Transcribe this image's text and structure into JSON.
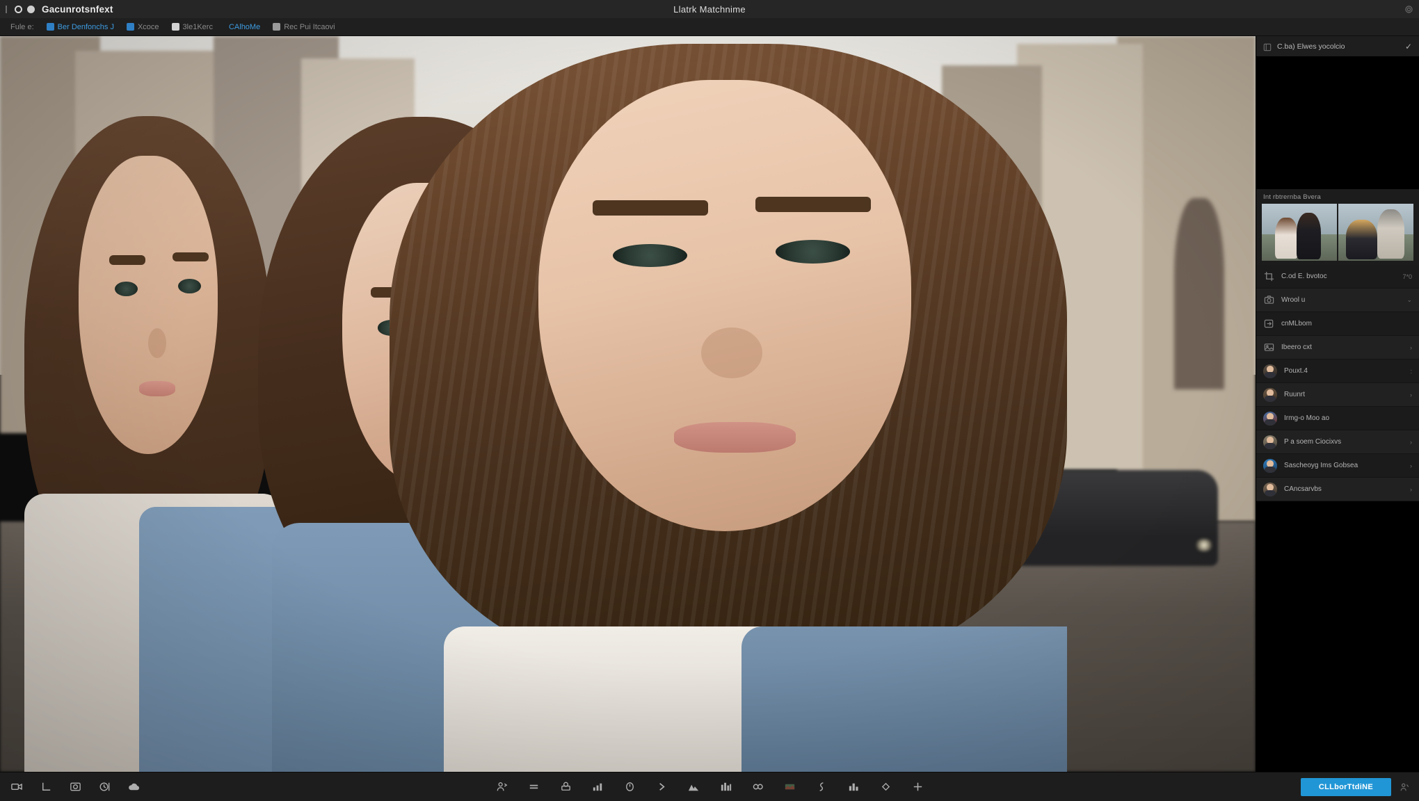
{
  "titlebar": {
    "app_name": "Gacunrotsnfext",
    "window_title": "Llatrk Matchnime",
    "drag_handle_icon": "drag-handle-icon",
    "logo_icon": "app-logo-icon",
    "status_dot_icon": "status-dot-icon",
    "settings_icon": "gear-icon"
  },
  "menubar": {
    "items": [
      {
        "label": "Fule e:",
        "icon": "none",
        "style": "muted"
      },
      {
        "label": "Ber Denfonchs J",
        "icon": "blue",
        "style": "accent"
      },
      {
        "label": "Xcoce",
        "icon": "blue",
        "style": "muted"
      },
      {
        "label": "3le1Kerc",
        "icon": "white",
        "style": "muted"
      },
      {
        "label": "CAlhoMe",
        "icon": "none",
        "style": "accent"
      },
      {
        "label": "Rec Pui Itcaovi",
        "icon": "grey",
        "style": "muted"
      }
    ]
  },
  "canvas": {
    "name": "photo-canvas",
    "description": "Street portrait photograph of three women"
  },
  "sidebar": {
    "header": {
      "label": "C.ba) Elwes yocolcio",
      "icon": "panel-icon",
      "check": "✓"
    },
    "section_title": "Int rbtrernba Bvera",
    "thumbnails": [
      {
        "name": "thumbnail-1"
      },
      {
        "name": "thumbnail-2"
      }
    ],
    "rows": [
      {
        "icon": "crop-icon",
        "label": "C.od E. bvotoc",
        "meta": "7*0",
        "chev": ""
      },
      {
        "icon": "camera-icon",
        "label": "Wrool u",
        "meta": "",
        "chev": "⌄"
      },
      {
        "icon": "tag-icon",
        "label": "cnMLbom",
        "meta": "",
        "chev": ""
      },
      {
        "icon": "image-icon",
        "label": "Ibeero cxt",
        "meta": "",
        "chev": "›"
      },
      {
        "icon": "avatar",
        "label": "Pouxt.4",
        "meta": "",
        "chev": ":"
      },
      {
        "icon": "avatar",
        "label": "Ruunrt",
        "meta": "",
        "chev": "›"
      },
      {
        "icon": "avatar",
        "label": "Irmg-o Moo ao",
        "meta": "",
        "chev": ""
      },
      {
        "icon": "avatar",
        "label": "P a soem Ciocixvs",
        "meta": "",
        "chev": "›"
      },
      {
        "icon": "avatar",
        "label": "Sascheoyg Ims Gobsea",
        "meta": "",
        "chev": "›"
      },
      {
        "icon": "avatar",
        "label": "CAncsarvbs",
        "meta": "",
        "chev": "›"
      }
    ]
  },
  "bottombar": {
    "left_tools": [
      {
        "name": "video-camera-icon"
      },
      {
        "name": "corner-crop-icon"
      },
      {
        "name": "photo-frame-icon"
      },
      {
        "name": "clock-icon"
      },
      {
        "name": "cloud-icon"
      }
    ],
    "center_tools": [
      {
        "name": "person-add-icon"
      },
      {
        "name": "equals-icon"
      },
      {
        "name": "stamp-icon"
      },
      {
        "name": "bar-chart-icon"
      },
      {
        "name": "clock-dial-icon"
      },
      {
        "name": "chevron-right-icon"
      },
      {
        "name": "mountains-icon"
      },
      {
        "name": "buildings-icon"
      },
      {
        "name": "link-icon"
      },
      {
        "name": "landscape-icon"
      },
      {
        "name": "curve-icon"
      },
      {
        "name": "city-icon"
      },
      {
        "name": "diamond-icon"
      },
      {
        "name": "plus-icon"
      }
    ],
    "primary_button": "CLLborTtdiNE",
    "user_icon": "user-icon"
  },
  "colors": {
    "accent": "#2196d6",
    "menu_accent": "#3d9be0",
    "titlebar_bg": "#262626",
    "menubar_bg": "#1f1f1f",
    "sidebar_bg": "#080808",
    "bottombar_bg": "#1d1d1d"
  }
}
